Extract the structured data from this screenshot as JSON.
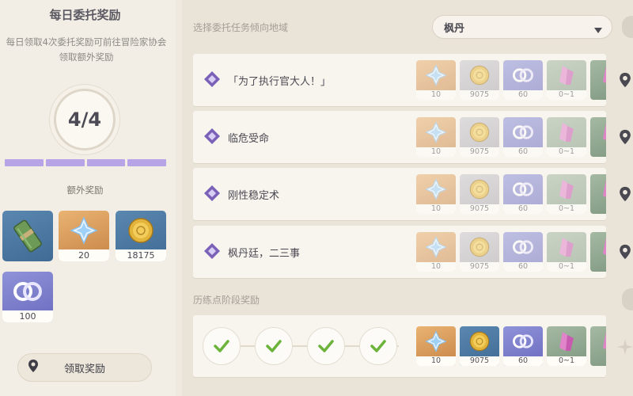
{
  "left": {
    "title": "每日委托奖励",
    "description": "每日领取4次委托奖励可前往冒险家协会领取额外奖励",
    "progress_text": "4/4",
    "progress": {
      "done": 4,
      "total": 4
    },
    "extra_label": "额外奖励",
    "extra_rewards": [
      {
        "icon": "scroll-bundle-icon",
        "qty": "",
        "bg": "#4f7ca5"
      },
      {
        "icon": "primogem-icon",
        "qty": "20",
        "bg": "#d99a5a"
      },
      {
        "icon": "mora-coin-icon",
        "qty": "18175",
        "bg": "#4f7ca5"
      },
      {
        "icon": "companionship-exp-icon",
        "qty": "100",
        "bg": "#7b7ccc"
      }
    ],
    "claim_button": "领取奖励"
  },
  "right": {
    "region_label": "选择委托任务倾向地域",
    "region_value": "枫丹",
    "quests": [
      {
        "name": "「为了执行官大人！」"
      },
      {
        "name": "临危受命"
      },
      {
        "name": "刚性稳定术"
      },
      {
        "name": "枫丹廷，二三事"
      }
    ],
    "quest_rewards": [
      {
        "icon": "primogem-icon",
        "qty": "10"
      },
      {
        "icon": "mora-coin-icon",
        "qty": "9075"
      },
      {
        "icon": "companionship-exp-icon",
        "qty": "60"
      },
      {
        "icon": "crystal-icon",
        "qty": "0~1"
      }
    ],
    "stage_label": "历练点阶段奖励",
    "stage_rewards": [
      {
        "icon": "primogem-icon",
        "qty": "10"
      },
      {
        "icon": "mora-coin-icon",
        "qty": "9075"
      },
      {
        "icon": "companionship-exp-icon",
        "qty": "60"
      },
      {
        "icon": "crystal-icon",
        "qty": "0~1"
      }
    ],
    "stage_checks": [
      true,
      true,
      true,
      true
    ]
  },
  "colors": {
    "progress_fill": "#b7a4e6",
    "check": "#6bb33a",
    "quest_icon": "#7b62b8"
  }
}
